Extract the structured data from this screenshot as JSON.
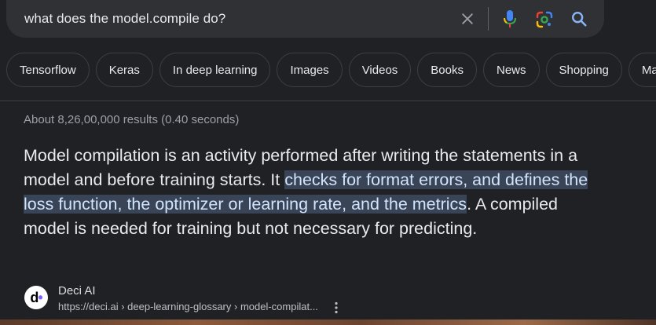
{
  "search": {
    "query": "what does the model.compile do?"
  },
  "chips": [
    {
      "label": "Tensorflow"
    },
    {
      "label": "Keras"
    },
    {
      "label": "In deep learning"
    },
    {
      "label": "Images"
    },
    {
      "label": "Videos"
    },
    {
      "label": "Books"
    },
    {
      "label": "News"
    },
    {
      "label": "Shopping"
    },
    {
      "label": "Maps"
    }
  ],
  "results": {
    "stats": "About 8,26,00,000 results (0.40 seconds)"
  },
  "snippet": {
    "text_before": "Model compilation is an activity performed after writing the statements in a model and before training starts. It ",
    "highlight": "checks for format errors, and defines the loss function, the optimizer or learning rate, and the metrics",
    "text_after": ". A compiled model is needed for training but not necessary for predicting."
  },
  "source": {
    "name": "Deci AI",
    "url": "https://deci.ai › deep-learning-glossary › model-compilat...",
    "favicon_letter": "d"
  },
  "icons": {
    "clear": "close-icon",
    "mic": "microphone-icon",
    "lens": "google-lens-icon",
    "search": "search-icon",
    "more": "more-vert-icon"
  },
  "colors": {
    "background": "#202124",
    "search_bar": "#303134",
    "highlight_bg": "#394457",
    "accent_blue": "#8ab4f8"
  }
}
